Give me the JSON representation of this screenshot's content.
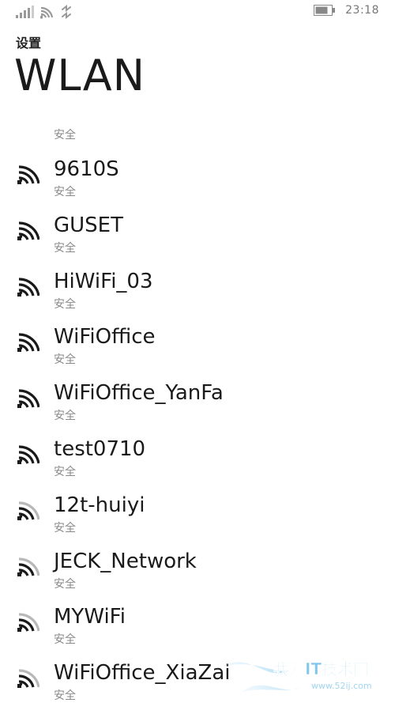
{
  "status": {
    "time": "23:18"
  },
  "header": {
    "settings_label": "设置",
    "title": "WLAN"
  },
  "partial_top_subtitle": "安全",
  "networks": [
    {
      "name": "9610S",
      "sub": "安全",
      "signal": "strong"
    },
    {
      "name": "GUSET",
      "sub": "安全",
      "signal": "strong"
    },
    {
      "name": "HiWiFi_03",
      "sub": "安全",
      "signal": "strong"
    },
    {
      "name": "WiFiOffice",
      "sub": "安全",
      "signal": "strong"
    },
    {
      "name": "WiFiOffice_YanFa",
      "sub": "安全",
      "signal": "strong"
    },
    {
      "name": "test0710",
      "sub": "安全",
      "signal": "strong"
    },
    {
      "name": "12t-huiyi",
      "sub": "安全",
      "signal": "medium"
    },
    {
      "name": "JECK_Network",
      "sub": "安全",
      "signal": "medium"
    },
    {
      "name": "MYWiFi",
      "sub": "安全",
      "signal": "medium"
    },
    {
      "name": "WiFiOffice_XiaZai",
      "sub": "安全",
      "signal": "medium"
    }
  ],
  "watermark": {
    "text": "我爱IT技术网",
    "url": "www.52ij.com"
  },
  "icons": {
    "cell_signal": "cellular-signal-icon",
    "wifi_status": "wifi-status-icon",
    "data_status": "data-status-icon",
    "battery": "battery-icon",
    "network": "wifi-signal-icon"
  },
  "colors": {
    "text": "#1a1a1a",
    "subtext": "#8a8a8a",
    "strong_signal": "#1a1a1a",
    "weak_bar": "#b8b8b8"
  }
}
